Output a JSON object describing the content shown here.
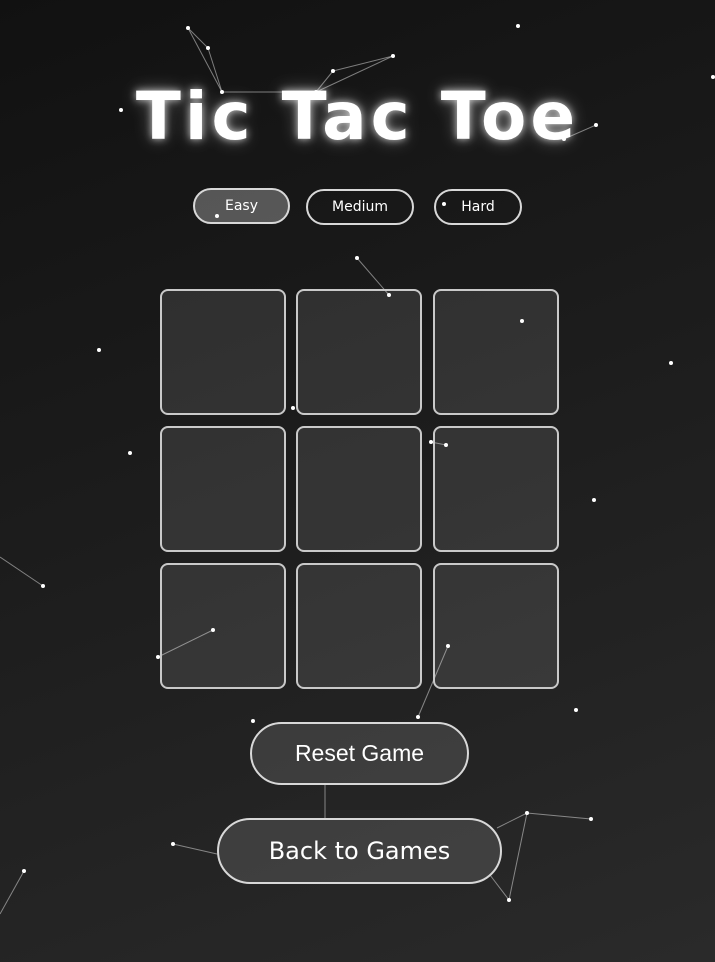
{
  "title": "Tic Tac Toe",
  "difficulty": {
    "options": [
      "Easy",
      "Medium",
      "Hard"
    ],
    "selected": "Easy"
  },
  "board": {
    "cells": [
      "",
      "",
      "",
      "",
      "",
      "",
      "",
      "",
      ""
    ]
  },
  "buttons": {
    "reset_label": "Reset Game",
    "back_label": "Back to Games"
  },
  "colors": {
    "background": "#1a1a1a",
    "accent": "#ffffff",
    "border": "#d8d8d8"
  }
}
